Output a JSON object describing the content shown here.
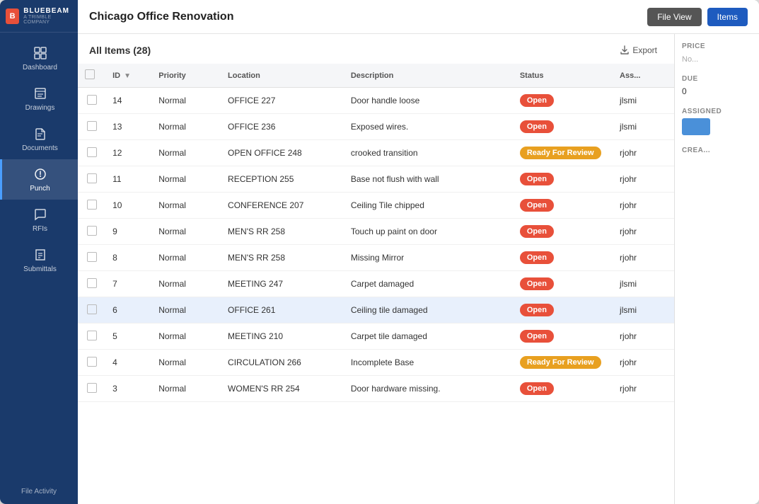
{
  "app": {
    "logo_main": "BLUEBEAM",
    "logo_sub": "A TRIMBLE COMPANY"
  },
  "header": {
    "title": "Chicago Office Renovation",
    "file_view_label": "File View",
    "items_label": "Items"
  },
  "toolbar": {
    "items_count_label": "All Items (28)",
    "export_label": "Export"
  },
  "sidebar": {
    "items": [
      {
        "id": "dashboard",
        "label": "Dashboard",
        "icon": "grid"
      },
      {
        "id": "drawings",
        "label": "Drawings",
        "icon": "drawings"
      },
      {
        "id": "documents",
        "label": "Documents",
        "icon": "documents"
      },
      {
        "id": "punch",
        "label": "Punch",
        "icon": "punch",
        "active": true
      },
      {
        "id": "rfis",
        "label": "RFIs",
        "icon": "rfis"
      },
      {
        "id": "submittals",
        "label": "Submittals",
        "icon": "submittals"
      }
    ],
    "footer_label": "File Activity"
  },
  "table": {
    "columns": [
      "",
      "ID",
      "Priority",
      "Location",
      "Description",
      "Status",
      "Assigned"
    ],
    "rows": [
      {
        "id": 14,
        "priority": "Normal",
        "location": "OFFICE 227",
        "description": "Door handle loose",
        "status": "Open",
        "assigned": "jlsmi"
      },
      {
        "id": 13,
        "priority": "Normal",
        "location": "OFFICE 236",
        "description": "Exposed wires.",
        "status": "Open",
        "assigned": "jlsmi"
      },
      {
        "id": 12,
        "priority": "Normal",
        "location": "OPEN OFFICE 248",
        "description": "crooked transition",
        "status": "Ready For Review",
        "assigned": "rjohr"
      },
      {
        "id": 11,
        "priority": "Normal",
        "location": "RECEPTION 255",
        "description": "Base not flush with wall",
        "status": "Open",
        "assigned": "rjohr"
      },
      {
        "id": 10,
        "priority": "Normal",
        "location": "CONFERENCE 207",
        "description": "Ceiling Tile chipped",
        "status": "Open",
        "assigned": "rjohr"
      },
      {
        "id": 9,
        "priority": "Normal",
        "location": "MEN'S RR 258",
        "description": "Touch up paint on door",
        "status": "Open",
        "assigned": "rjohr"
      },
      {
        "id": 8,
        "priority": "Normal",
        "location": "MEN'S RR 258",
        "description": "Missing Mirror",
        "status": "Open",
        "assigned": "rjohr"
      },
      {
        "id": 7,
        "priority": "Normal",
        "location": "MEETING 247",
        "description": "Carpet damaged",
        "status": "Open",
        "assigned": "jlsmi"
      },
      {
        "id": 6,
        "priority": "Normal",
        "location": "OFFICE 261",
        "description": "Ceiling tile damaged",
        "status": "Open",
        "assigned": "jlsmi",
        "selected": true
      },
      {
        "id": 5,
        "priority": "Normal",
        "location": "MEETING 210",
        "description": "Carpet tile damaged",
        "status": "Open",
        "assigned": "rjohr"
      },
      {
        "id": 4,
        "priority": "Normal",
        "location": "CIRCULATION 266",
        "description": "Incomplete Base",
        "status": "Ready For Review",
        "assigned": "rjohr"
      },
      {
        "id": 3,
        "priority": "Normal",
        "location": "WOMEN'S RR 254",
        "description": "Door hardware missing.",
        "status": "Open",
        "assigned": "rjohr"
      }
    ]
  },
  "right_panel": {
    "price_label": "Price",
    "price_value": "No...",
    "due_label": "Due",
    "due_value": "0",
    "assigned_label": "Assigned",
    "created_label": "Crea..."
  }
}
